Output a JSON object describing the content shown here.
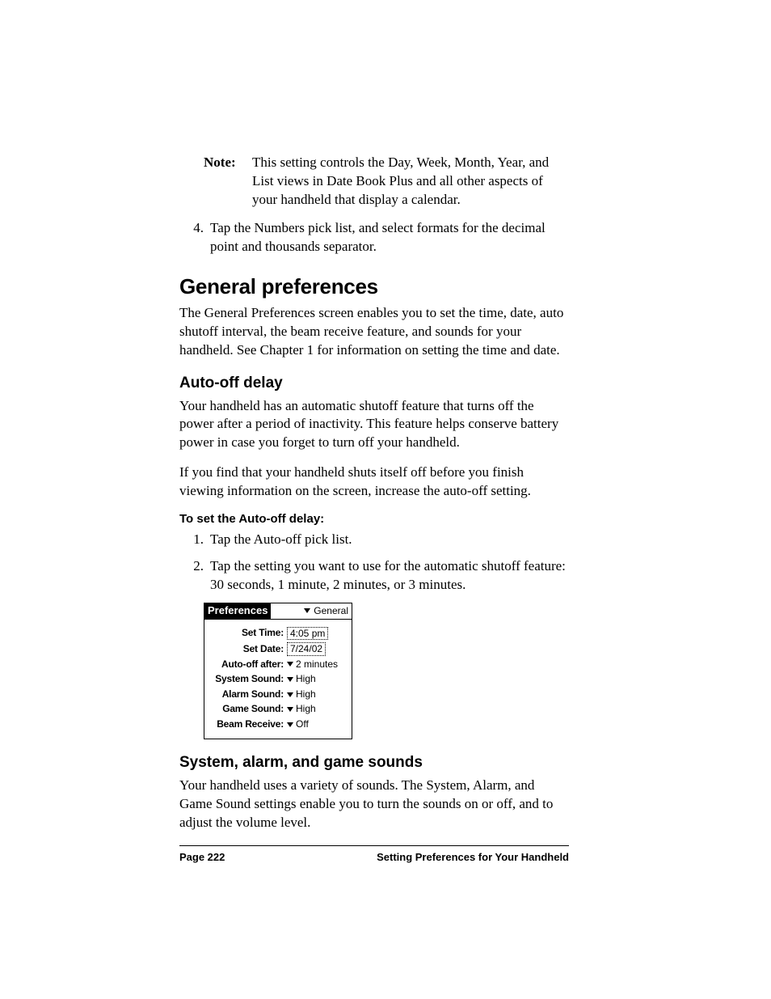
{
  "note": {
    "label": "Note:",
    "text": "This setting controls the Day, Week, Month, Year, and List views in Date Book Plus and all other aspects of your handheld that display a calendar."
  },
  "step4": {
    "num": "4.",
    "text": "Tap the Numbers pick list, and select formats for the decimal point and thousands separator."
  },
  "heading_general": "General preferences",
  "general_intro": "The General Preferences screen enables you to set the time, date, auto shutoff interval, the beam receive feature, and sounds for your handheld. See Chapter 1 for information on setting the time and date.",
  "heading_autooff": "Auto-off delay",
  "autooff_p1": "Your handheld has an automatic shutoff feature that turns off the power after a period of inactivity. This feature helps conserve battery power in case you forget to turn off your handheld.",
  "autooff_p2": "If you find that your handheld shuts itself off before you finish viewing information on the screen, increase the auto-off setting.",
  "proc_heading": "To set the Auto-off delay:",
  "proc1": {
    "num": "1.",
    "text": "Tap the Auto-off pick list."
  },
  "proc2": {
    "num": "2.",
    "text": "Tap the setting you want to use for the automatic shutoff feature: 30 seconds, 1 minute, 2 minutes, or 3 minutes."
  },
  "palm": {
    "title": "Preferences",
    "category": "General",
    "rows": {
      "set_time": {
        "label": "Set Time:",
        "value": "4:05 pm"
      },
      "set_date": {
        "label": "Set Date:",
        "value": "7/24/02"
      },
      "auto_off": {
        "label": "Auto-off after:",
        "value": "2 minutes"
      },
      "sys_sound": {
        "label": "System Sound:",
        "value": "High"
      },
      "alarm": {
        "label": "Alarm Sound:",
        "value": "High"
      },
      "game": {
        "label": "Game Sound:",
        "value": "High"
      },
      "beam": {
        "label": "Beam Receive:",
        "value": "Off"
      }
    }
  },
  "heading_sounds": "System, alarm, and game sounds",
  "sounds_p": "Your handheld uses a variety of sounds. The System, Alarm, and Game Sound settings enable you to turn the sounds on or off, and to adjust the volume level.",
  "footer": {
    "left": "Page 222",
    "right": "Setting Preferences for Your Handheld"
  }
}
